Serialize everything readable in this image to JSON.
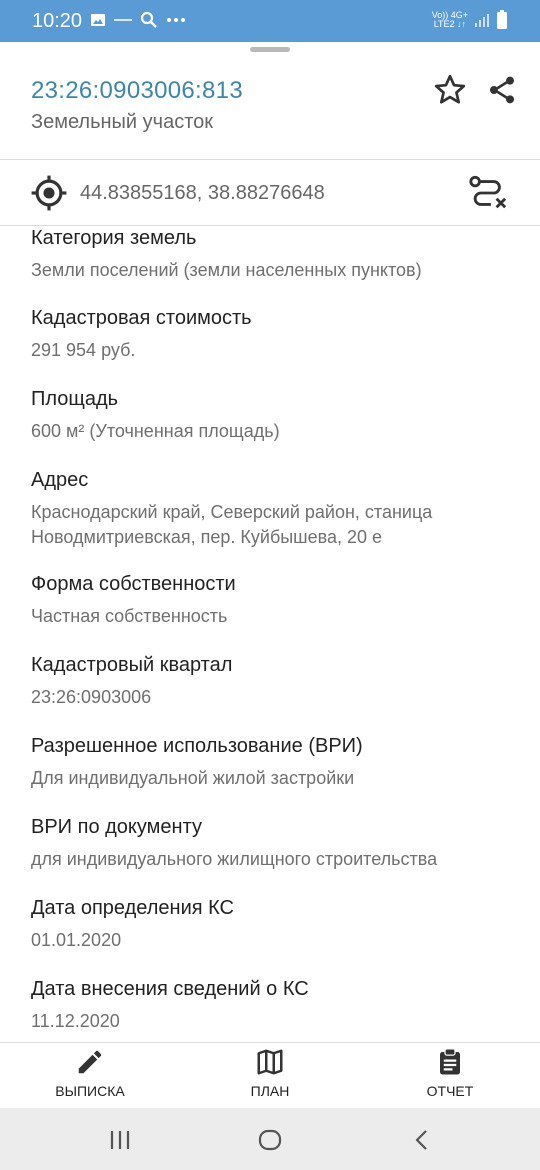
{
  "status_bar": {
    "time": "10:20",
    "network_top": "Vo)) 4G+",
    "network_bottom": "LTE2 ↓↑",
    "left_icons": [
      "image-icon",
      "small-text-icon",
      "search-icon",
      "more-dots-icon"
    ],
    "right_icons": [
      "signal-icon",
      "battery-icon"
    ]
  },
  "header": {
    "cadastral_number": "23:26:0903006:813",
    "object_type": "Земельный участок",
    "icons": [
      "star-outline-icon",
      "share-icon"
    ]
  },
  "coordinates": {
    "text": "44.83855168, 38.88276648",
    "icons": [
      "gps-target-icon",
      "route-icon"
    ]
  },
  "details": [
    {
      "label": "Категория земель",
      "value": "Земли поселений (земли населенных пунктов)"
    },
    {
      "label": "Кадастровая стоимость",
      "value": "291 954 руб."
    },
    {
      "label": "Площадь",
      "value": "600 м² (Уточненная площадь)"
    },
    {
      "label": "Адрес",
      "value_lines": [
        "Краснодарский край, Северский район, станица",
        "Новодмитриевская, пер. Куйбышева, 20 е"
      ]
    },
    {
      "label": "Форма собственности",
      "value": "Частная собственность"
    },
    {
      "label": "Кадастровый квартал",
      "value": "23:26:0903006"
    },
    {
      "label": "Разрешенное использование (ВРИ)",
      "value": "Для индивидуальной жилой застройки"
    },
    {
      "label": "ВРИ по документу",
      "value": "для индивидуального жилищного строительства"
    },
    {
      "label": "Дата определения КС",
      "value": "01.01.2020"
    },
    {
      "label": "Дата внесения сведений о КС",
      "value": "11.12.2020"
    }
  ],
  "bottom_nav": [
    {
      "label": "ВЫПИСКА",
      "icon": "pencil-icon"
    },
    {
      "label": "ПЛАН",
      "icon": "map-icon"
    },
    {
      "label": "ОТЧЕТ",
      "icon": "clipboard-icon"
    }
  ],
  "system_nav": [
    "recent-apps-icon",
    "home-icon",
    "back-icon"
  ],
  "colors": {
    "status_bar": "#5b9bd5",
    "accent": "#3d86a8",
    "label_text": "#222222",
    "value_text": "#6f6f6f",
    "divider": "#dcdcdc",
    "system_nav": "#ececec"
  }
}
